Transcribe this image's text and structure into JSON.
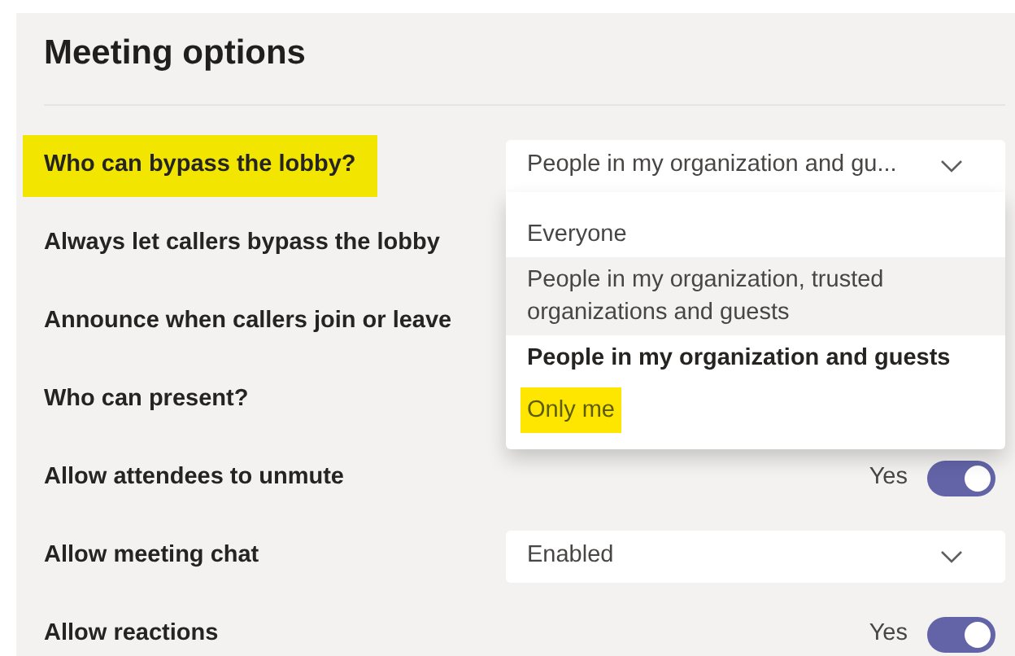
{
  "title": "Meeting options",
  "rows": [
    {
      "kind": "dropdown",
      "label": "Who can bypass the lobby?",
      "highlighted": true,
      "value": "People in my organization and gu...",
      "expanded": true,
      "options": [
        {
          "label": "Everyone",
          "selected": false,
          "hovered": false,
          "highlighted": false
        },
        {
          "label": "People in my organization, trusted organizations and guests",
          "selected": false,
          "hovered": true,
          "highlighted": false
        },
        {
          "label": "People in my organization and guests",
          "selected": true,
          "hovered": false,
          "highlighted": false
        },
        {
          "label": "Only me",
          "selected": false,
          "hovered": false,
          "highlighted": true
        }
      ]
    },
    {
      "kind": "plain",
      "label": "Always let callers bypass the lobby",
      "highlighted": false
    },
    {
      "kind": "plain",
      "label": "Announce when callers join or leave",
      "highlighted": false
    },
    {
      "kind": "plain",
      "label": "Who can present?",
      "highlighted": false
    },
    {
      "kind": "toggle",
      "label": "Allow attendees to unmute",
      "highlighted": false,
      "reading": "Yes",
      "on": true
    },
    {
      "kind": "dropdown",
      "label": "Allow meeting chat",
      "highlighted": false,
      "value": "Enabled",
      "expanded": false
    },
    {
      "kind": "toggle",
      "label": "Allow reactions",
      "highlighted": false,
      "reading": "Yes",
      "on": true
    }
  ]
}
